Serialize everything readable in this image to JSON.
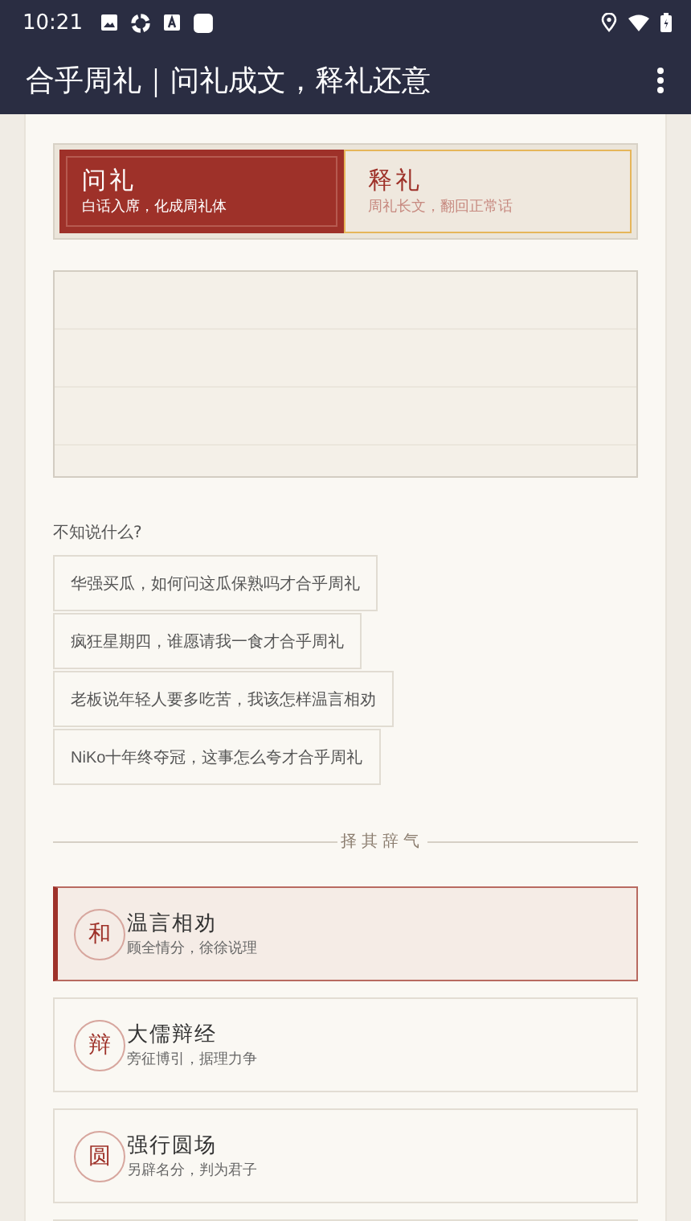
{
  "status_bar": {
    "time": "10:21"
  },
  "app_bar": {
    "title": "合乎周礼｜问礼成文，释礼还意"
  },
  "tabs": [
    {
      "label": "问礼",
      "subtitle": "白话入席，化成周礼体",
      "selected": true
    },
    {
      "label": "释礼",
      "subtitle": "周礼长文，翻回正常话",
      "selected": false
    }
  ],
  "prompt_label": "不知说什么?",
  "suggestions": [
    "华强买瓜，如何问这瓜保熟吗才合乎周礼",
    "疯狂星期四，谁愿请我一食才合乎周礼",
    "老板说年轻人要多吃苦，我该怎样温言相劝",
    "NiKo十年终夺冠，这事怎么夸才合乎周礼"
  ],
  "section_title": "择其辞气",
  "styles": [
    {
      "seal": "和",
      "title": "温言相劝",
      "subtitle": "顾全情分，徐徐说理",
      "selected": true
    },
    {
      "seal": "辩",
      "title": "大儒辩经",
      "subtitle": "旁征博引，据理力争",
      "selected": false
    },
    {
      "seal": "圆",
      "title": "强行圆场",
      "subtitle": "另辟名分，判为君子",
      "selected": false
    }
  ]
}
